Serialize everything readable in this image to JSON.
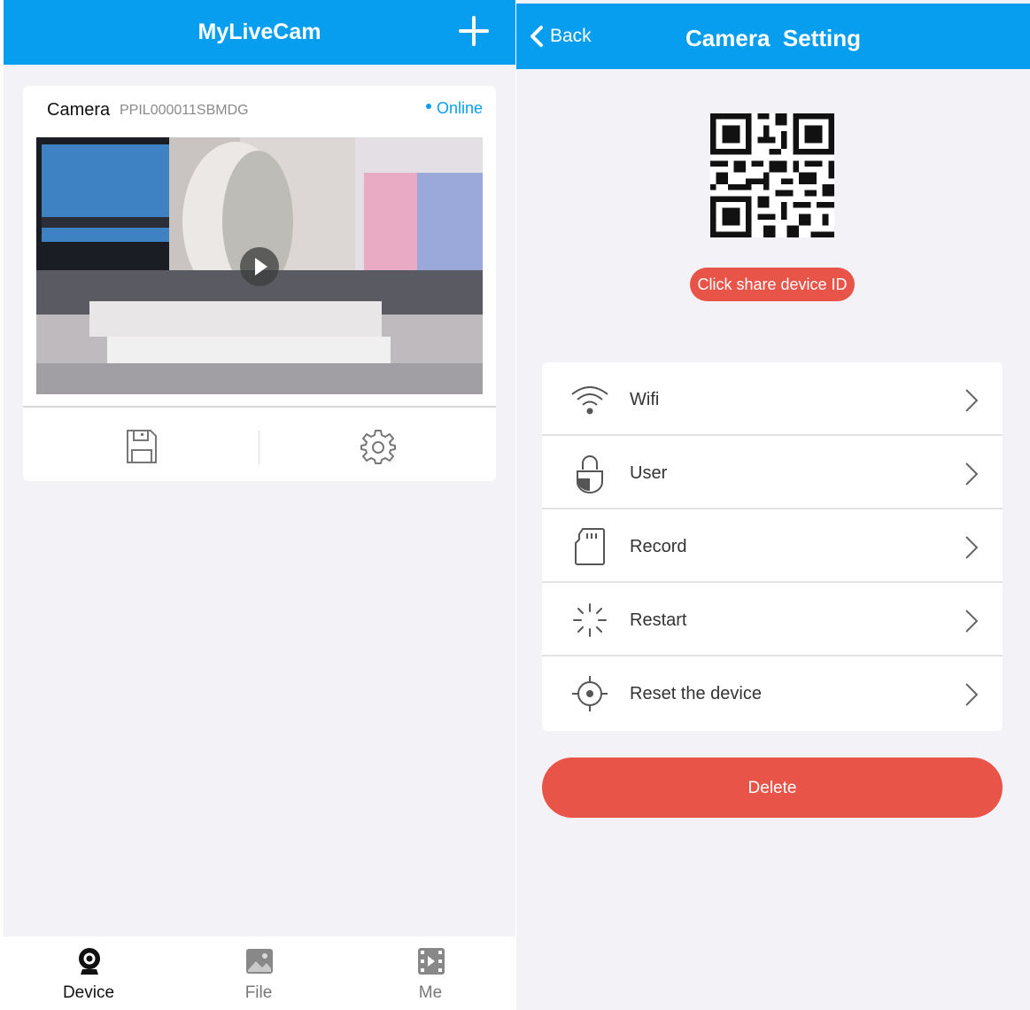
{
  "device_screen": {
    "title": "MyLiveCam",
    "camera": {
      "name": "Camera",
      "id": "PPIL000011SBMDG",
      "status": "Online"
    },
    "bottom_nav": [
      {
        "label": "Device",
        "icon": "webcam-icon",
        "active": true
      },
      {
        "label": "File",
        "icon": "image-icon",
        "active": false
      },
      {
        "label": "Me",
        "icon": "film-icon",
        "active": false
      }
    ]
  },
  "settings_screen": {
    "title": "Camera  Setting",
    "back_label": "Back",
    "share_label": "Click share device ID",
    "menu": [
      {
        "label": "Wifi",
        "icon": "wifi-icon"
      },
      {
        "label": "User",
        "icon": "lock-icon"
      },
      {
        "label": "Record",
        "icon": "sd-card-icon"
      },
      {
        "label": "Restart",
        "icon": "loading-spinner-icon"
      },
      {
        "label": "Reset the device",
        "icon": "target-icon"
      }
    ],
    "delete_label": "Delete"
  },
  "colors": {
    "header_blue": "#089eef",
    "accent_red": "#e85448",
    "background": "#f3f2f6"
  }
}
